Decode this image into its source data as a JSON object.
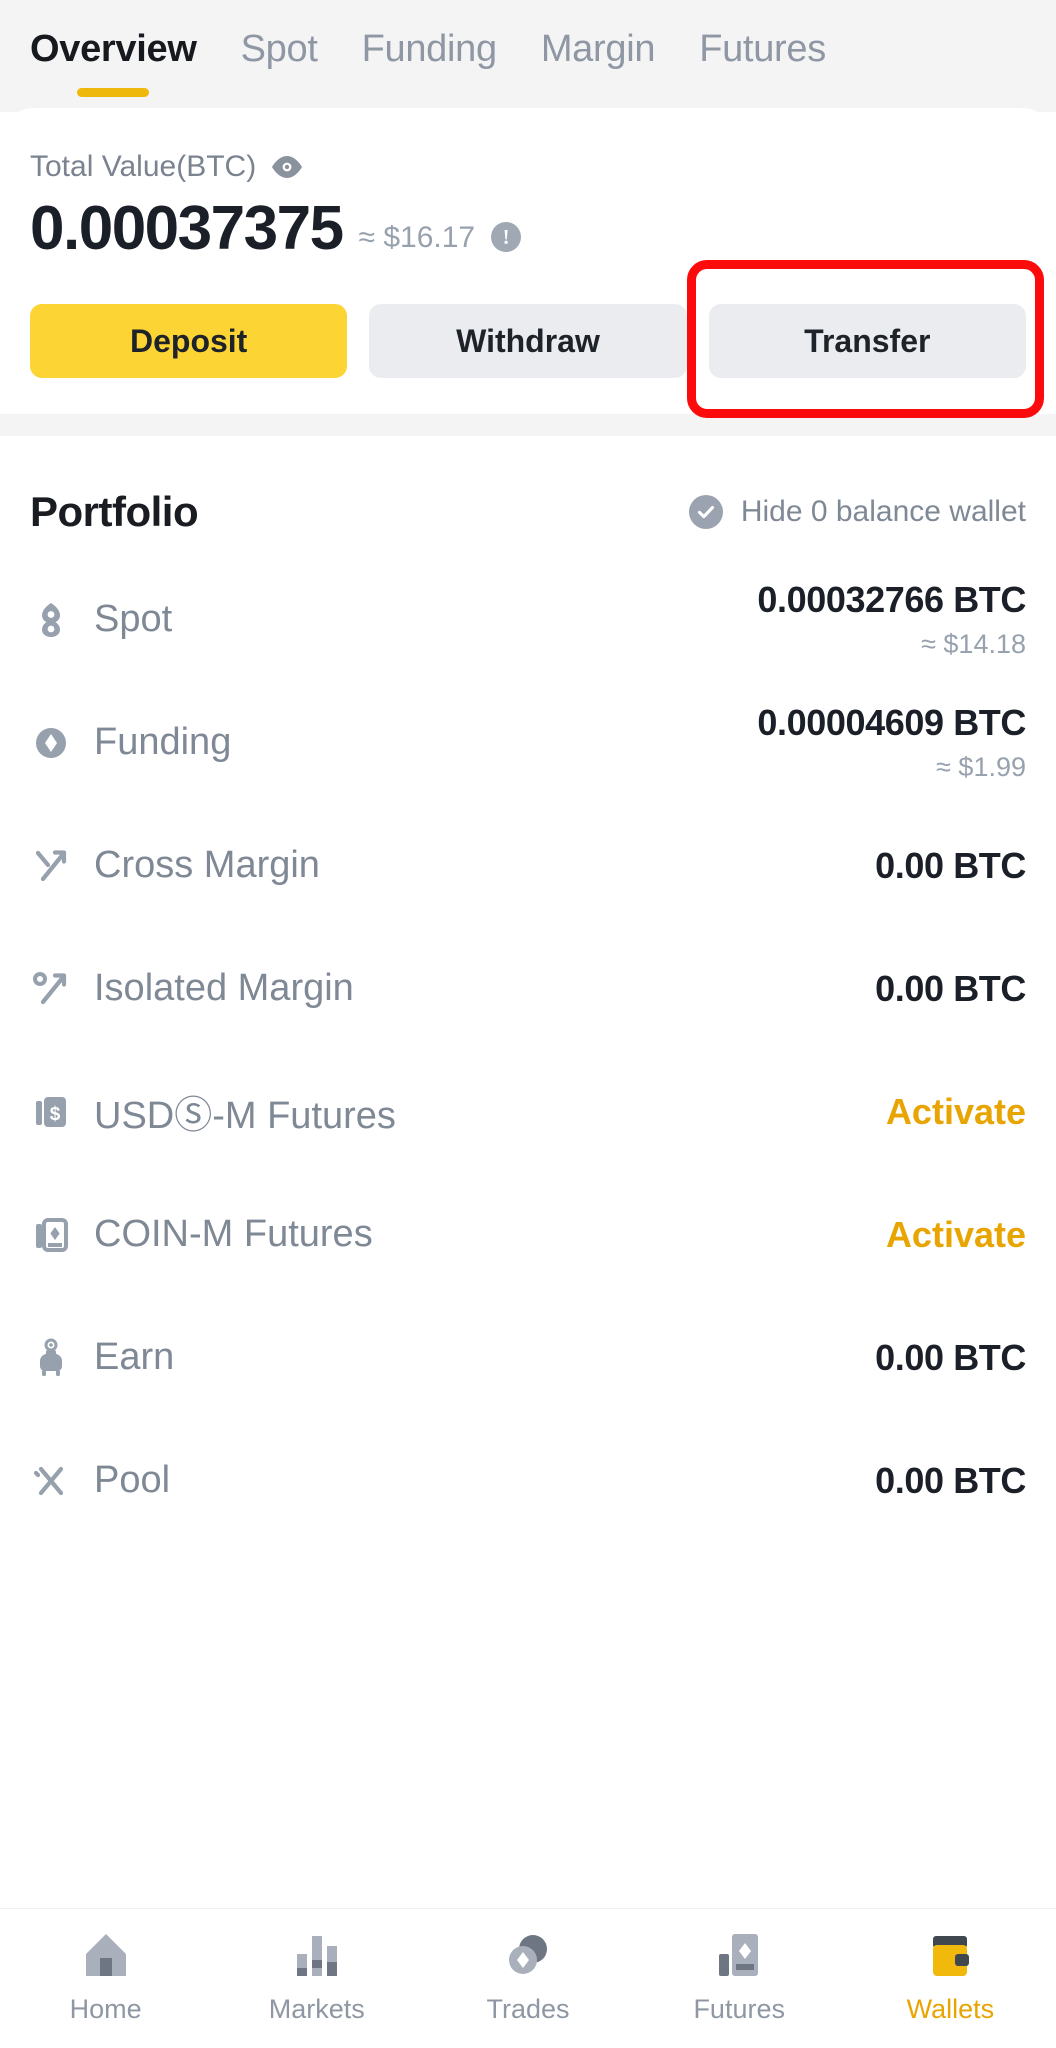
{
  "tabs": [
    {
      "label": "Overview",
      "active": true
    },
    {
      "label": "Spot",
      "active": false
    },
    {
      "label": "Funding",
      "active": false
    },
    {
      "label": "Margin",
      "active": false
    },
    {
      "label": "Futures",
      "active": false
    }
  ],
  "balance_card": {
    "total_label": "Total Value(BTC)",
    "eye_icon": "eye-visible-icon",
    "amount": "0.00037375",
    "approx_value": "≈ $16.17",
    "info_icon": "info-icon",
    "info_glyph": "!",
    "buttons": [
      {
        "label": "Deposit",
        "style": "primary",
        "name": "deposit-button"
      },
      {
        "label": "Withdraw",
        "style": "secondary",
        "name": "withdraw-button"
      },
      {
        "label": "Transfer",
        "style": "secondary",
        "name": "transfer-button",
        "highlighted": true
      }
    ]
  },
  "portfolio": {
    "title": "Portfolio",
    "hide_toggle_label": "Hide 0 balance wallet",
    "hide_toggle_checked": true,
    "check_icon": "check-circle-icon",
    "rows": [
      {
        "name": "Spot",
        "icon": "spot-icon",
        "value": "0.00032766 BTC",
        "sub": "≈ $14.18",
        "action": null
      },
      {
        "name": "Funding",
        "icon": "funding-icon",
        "value": "0.00004609 BTC",
        "sub": "≈ $1.99",
        "action": null
      },
      {
        "name": "Cross Margin",
        "icon": "cross-margin-icon",
        "value": "0.00 BTC",
        "sub": null,
        "action": null
      },
      {
        "name": "Isolated Margin",
        "icon": "isolated-margin-icon",
        "value": "0.00 BTC",
        "sub": null,
        "action": null
      },
      {
        "name": "USDⓈ-M Futures",
        "icon": "usd-m-futures-icon",
        "value": null,
        "sub": null,
        "action": "Activate"
      },
      {
        "name": "COIN-M Futures",
        "icon": "coin-m-futures-icon",
        "value": null,
        "sub": null,
        "action": "Activate"
      },
      {
        "name": "Earn",
        "icon": "earn-piggy-icon",
        "value": "0.00 BTC",
        "sub": null,
        "action": null
      },
      {
        "name": "Pool",
        "icon": "pool-icon",
        "value": "0.00 BTC",
        "sub": null,
        "action": null
      }
    ]
  },
  "bottom_nav": [
    {
      "label": "Home",
      "icon": "home-icon",
      "active": false
    },
    {
      "label": "Markets",
      "icon": "markets-bars-icon",
      "active": false
    },
    {
      "label": "Trades",
      "icon": "trades-icon",
      "active": false
    },
    {
      "label": "Futures",
      "icon": "futures-icon",
      "active": false
    },
    {
      "label": "Wallets",
      "icon": "wallet-icon",
      "active": true
    }
  ],
  "colors": {
    "brand_yellow": "#FCD535",
    "accent_amber": "#EFB80C",
    "activate_amber": "#E8A400",
    "highlight_red": "#FB0B0B",
    "header_bg": "#F4F4F5",
    "secondary_btn": "#EAECEF",
    "text_primary": "#1B1F27",
    "text_muted": "#7F8895"
  }
}
